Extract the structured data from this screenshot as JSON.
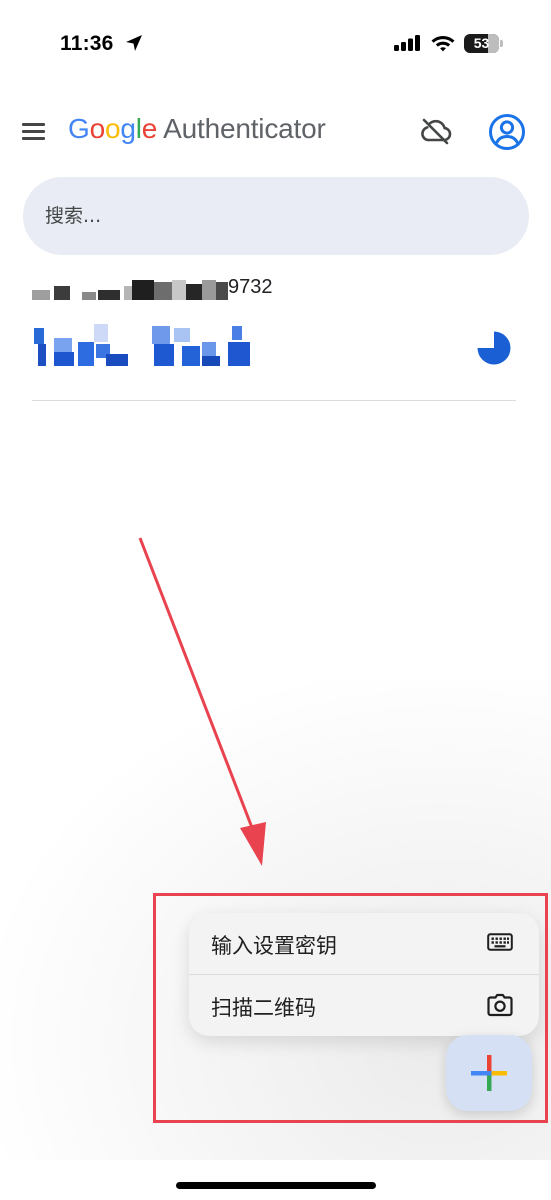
{
  "status_bar": {
    "time": "11:36",
    "battery": "53"
  },
  "app_bar": {
    "title_letters": [
      "G",
      "o",
      "o",
      "g",
      "l",
      "e"
    ],
    "title_product": "Authenticator",
    "icons": [
      "menu-icon",
      "cloud-off-icon",
      "account-circle-icon"
    ]
  },
  "search": {
    "placeholder": "搜索..."
  },
  "entry": {
    "label_visible_suffix": "9732",
    "timer_icon": "countdown-timer-icon"
  },
  "popup_menu": {
    "items": [
      {
        "label": "输入设置密钥",
        "icon": "keyboard-icon"
      },
      {
        "label": "扫描二维码",
        "icon": "camera-icon"
      }
    ]
  },
  "fab": {
    "icon": "plus-icon"
  },
  "colors": {
    "google_blue": "#4285F4",
    "google_red": "#EA4335",
    "google_yellow": "#FBBC05",
    "google_green": "#34A853",
    "annotation_red": "#e8434f",
    "account_blue": "#1a73e8"
  }
}
